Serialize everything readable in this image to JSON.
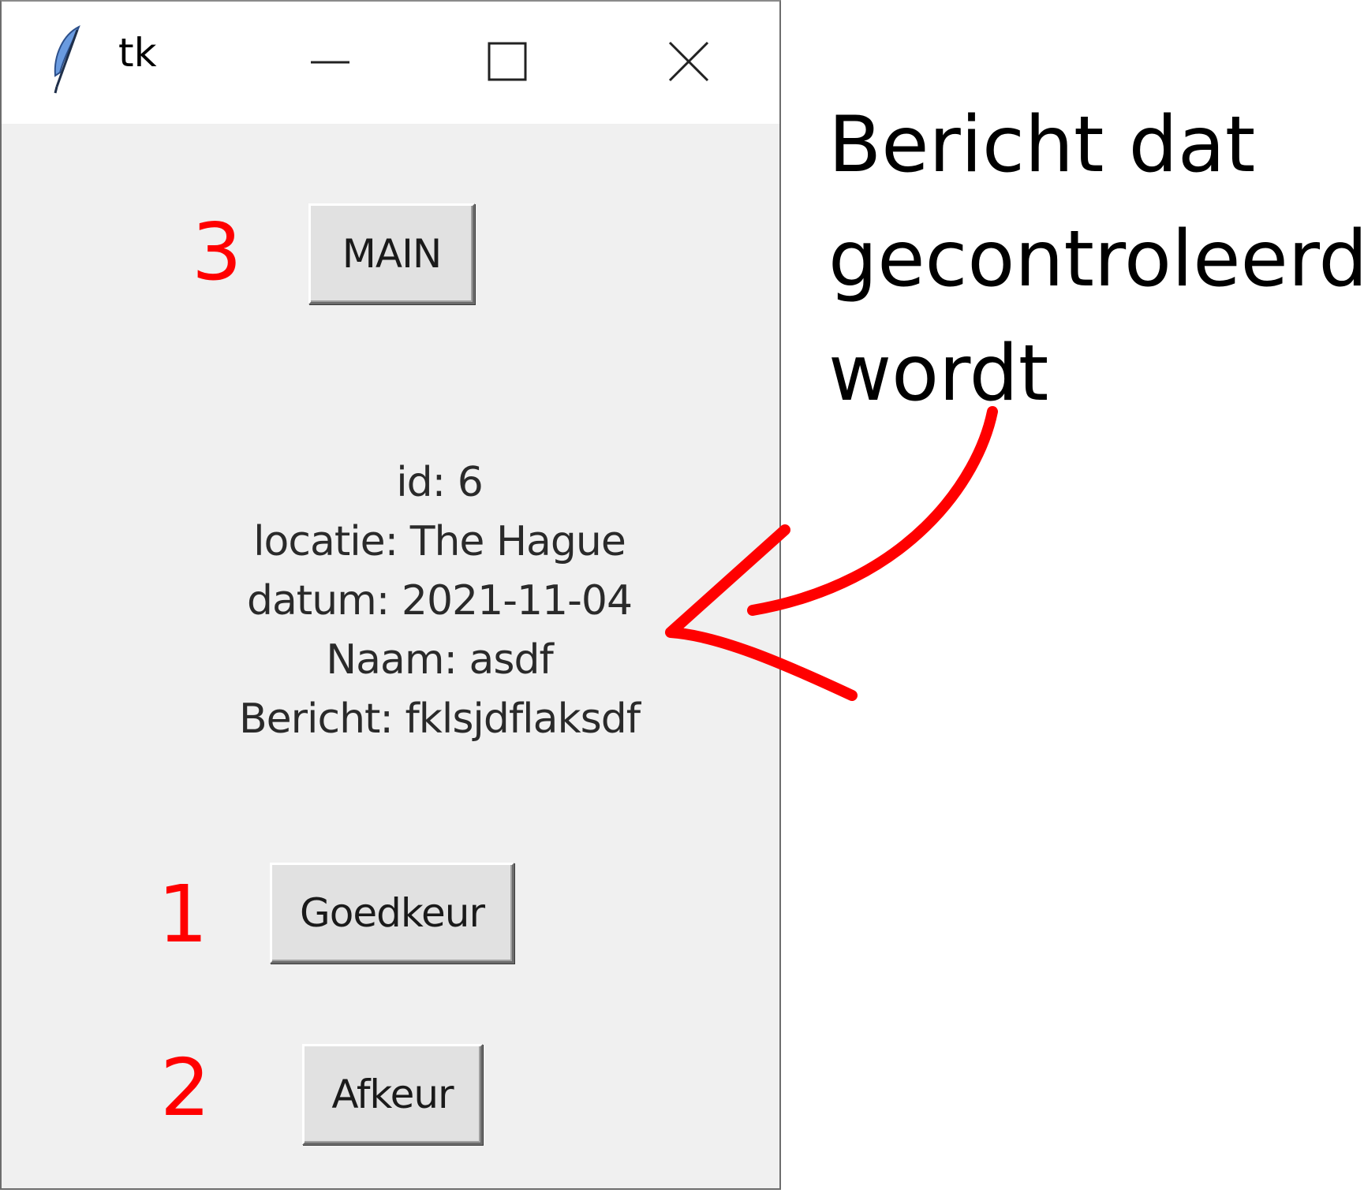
{
  "window": {
    "title": "tk",
    "icon": "feather-icon",
    "controls": [
      "minimize-icon",
      "maximize-icon",
      "close-icon"
    ]
  },
  "buttons": {
    "main": "MAIN",
    "approve": "Goedkeur",
    "reject": "Afkeur"
  },
  "info": {
    "line1": "id: 6",
    "line2": "locatie: The Hague",
    "line3": "datum: 2021-11-04",
    "line4": "Naam: asdf",
    "line5": "Bericht: fklsjdflaksdf"
  },
  "annotations": {
    "num_main": "3",
    "num_approve": "1",
    "num_reject": "2",
    "note_line1": "Bericht dat",
    "note_line2": "gecontroleerd",
    "note_line3": "wordt",
    "accent_color": "#ff0000"
  }
}
